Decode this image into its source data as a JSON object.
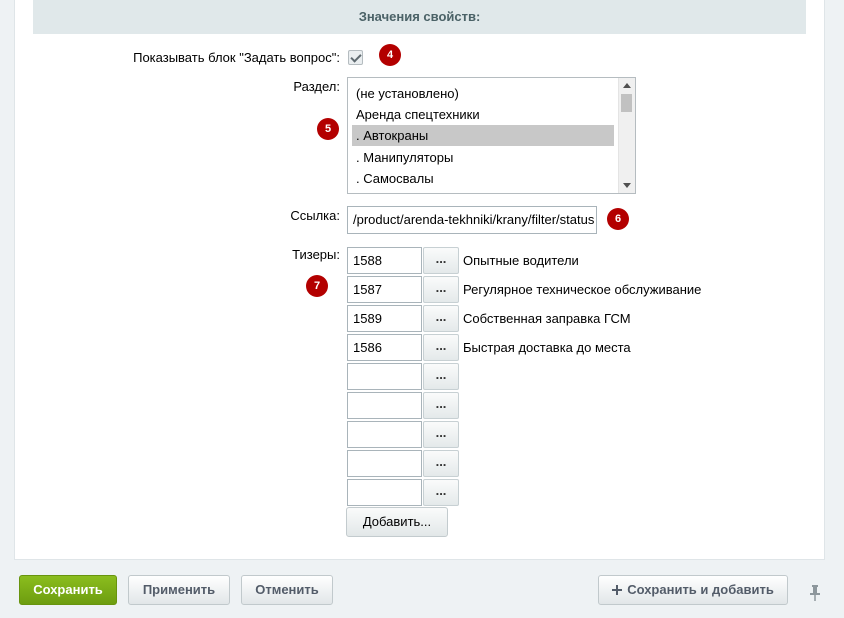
{
  "section": {
    "title": "Значения свойств:"
  },
  "show_block": {
    "label": "Показывать блок \"Задать вопрос\":",
    "checked": true,
    "badge": "4"
  },
  "section_field": {
    "label": "Раздел:",
    "badge": "5",
    "options": [
      "(не установлено)",
      "Аренда спецтехники",
      ". Автокраны",
      ". Манипуляторы",
      ". Самосвалы"
    ],
    "selected": ". Автокраны"
  },
  "link_field": {
    "label": "Ссылка:",
    "value": "/product/arenda-tekhniki/krany/filter/status",
    "badge": "6"
  },
  "teasers": {
    "label": "Тизеры:",
    "badge": "7",
    "button_label": "...",
    "rows": [
      {
        "id": "1588",
        "name": "Опытные водители"
      },
      {
        "id": "1587",
        "name": "Регулярное техническое обслуживание"
      },
      {
        "id": "1589",
        "name": "Собственная заправка ГСМ"
      },
      {
        "id": "1586",
        "name": "Быстрая доставка до места"
      },
      {
        "id": "",
        "name": ""
      },
      {
        "id": "",
        "name": ""
      },
      {
        "id": "",
        "name": ""
      },
      {
        "id": "",
        "name": ""
      },
      {
        "id": "",
        "name": ""
      }
    ],
    "add_label": "Добавить..."
  },
  "footer": {
    "save": "Сохранить",
    "apply": "Применить",
    "cancel": "Отменить",
    "save_and_add": "Сохранить и добавить",
    "pin_icon": "pin-icon"
  },
  "colors": {
    "badge": "#b30000",
    "save_button": "#7fb11a",
    "header_bg": "#e0e8ea"
  }
}
